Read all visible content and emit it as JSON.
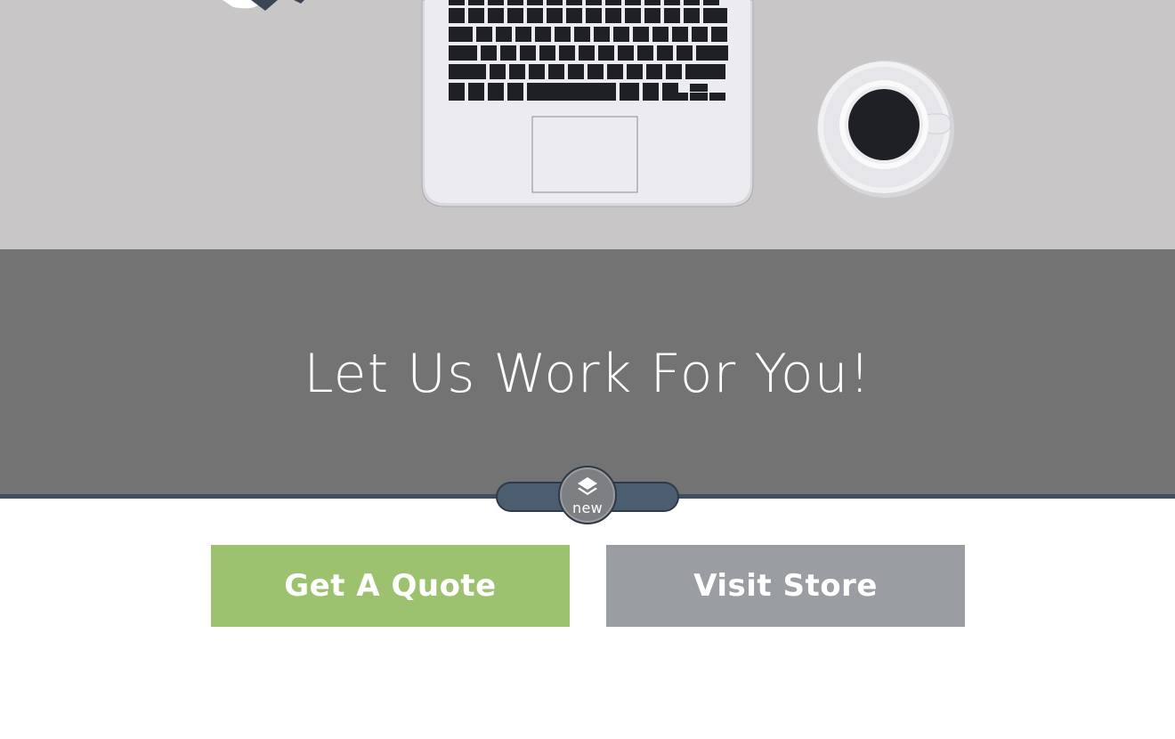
{
  "banner": {
    "title": "Let Us Work For You!"
  },
  "badge": {
    "label": "new",
    "icon": "layers-icon"
  },
  "buttons": {
    "quote_label": "Get A Quote",
    "store_label": "Visit Store"
  },
  "colors": {
    "hero_background": "#c8c6c7",
    "banner_background": "#737373",
    "quote_button": "#9dc26f",
    "store_button": "#9a9da1",
    "badge_navy": "#3f4d5e"
  }
}
